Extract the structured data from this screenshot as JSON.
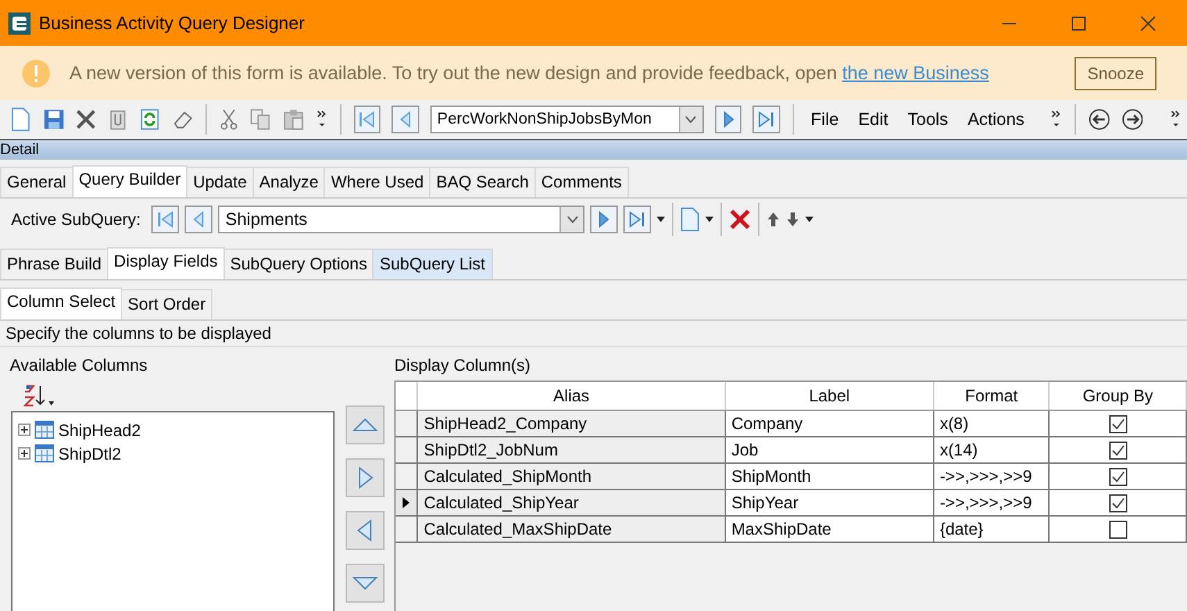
{
  "window": {
    "title": "Business Activity Query Designer"
  },
  "banner": {
    "message": "A new version of this form is available. To try out the new design and provide feedback, open",
    "link": "the new Business",
    "button": "Snooze"
  },
  "toolbar": {
    "query": "PercWorkNonShipJobsByMon",
    "menus": [
      "File",
      "Edit",
      "Tools",
      "Actions"
    ]
  },
  "section": "Detail",
  "tabs": [
    {
      "label": "General",
      "selected": false
    },
    {
      "label": "Query Builder",
      "selected": true
    },
    {
      "label": "Update",
      "selected": false
    },
    {
      "label": "Analyze",
      "selected": false
    },
    {
      "label": "Where Used",
      "selected": false
    },
    {
      "label": "BAQ Search",
      "selected": false
    },
    {
      "label": "Comments",
      "selected": false
    }
  ],
  "active_subquery": {
    "label": "Active SubQuery:",
    "value": "Shipments"
  },
  "subtabs": [
    {
      "label": "Phrase Build",
      "selected": false,
      "hovered": false
    },
    {
      "label": "Display Fields",
      "selected": true,
      "hovered": false
    },
    {
      "label": "SubQuery Options",
      "selected": false,
      "hovered": false
    },
    {
      "label": "SubQuery List",
      "selected": false,
      "hovered": true
    }
  ],
  "inner_tabs": [
    {
      "label": "Column Select",
      "selected": true
    },
    {
      "label": "Sort Order",
      "selected": false
    }
  ],
  "instruction": "Specify the columns to be displayed",
  "available": {
    "title": "Available Columns",
    "tree": [
      {
        "label": "ShipHead2",
        "expanded": false
      },
      {
        "label": "ShipDtl2",
        "expanded": false
      }
    ]
  },
  "display": {
    "title": "Display Column(s)",
    "columns": [
      "Alias",
      "Label",
      "Format",
      "Group By"
    ],
    "rows": [
      {
        "alias": "ShipHead2_Company",
        "label": "Company",
        "format": "x(8)",
        "group_by": true,
        "current": false
      },
      {
        "alias": "ShipDtl2_JobNum",
        "label": "Job",
        "format": "x(14)",
        "group_by": true,
        "current": false
      },
      {
        "alias": "Calculated_ShipMonth",
        "label": "ShipMonth",
        "format": "->>,>>>,>>9",
        "group_by": true,
        "current": false
      },
      {
        "alias": "Calculated_ShipYear",
        "label": "ShipYear",
        "format": "->>,>>>,>>9",
        "group_by": true,
        "current": true
      },
      {
        "alias": "Calculated_MaxShipDate",
        "label": "MaxShipDate",
        "format": "{date}",
        "group_by": false,
        "current": false
      }
    ]
  }
}
